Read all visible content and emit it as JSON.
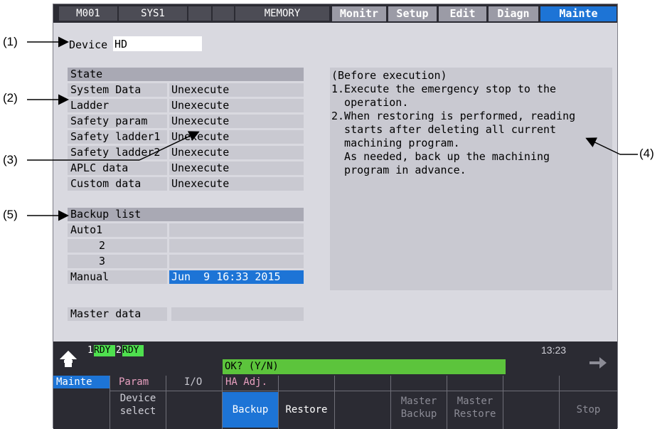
{
  "callouts": [
    "(1)",
    "(2)",
    "(3)",
    "(4)",
    "(5)"
  ],
  "topbar": {
    "cells": [
      "M001",
      "SYS1",
      "",
      "",
      "MEMORY"
    ],
    "tabs": [
      "Monitr",
      "Setup",
      "Edit",
      "Diagn",
      "Mainte"
    ],
    "active_tab": "Mainte"
  },
  "device": {
    "label": "Device",
    "value": "HD"
  },
  "state": {
    "header": "State",
    "rows": [
      {
        "label": "System Data",
        "value": "Unexecute"
      },
      {
        "label": "Ladder",
        "value": "Unexecute"
      },
      {
        "label": "Safety param",
        "value": "Unexecute"
      },
      {
        "label": "Safety ladder1",
        "value": "Unexecute"
      },
      {
        "label": "Safety ladder2",
        "value": "Unexecute"
      },
      {
        "label": "APLC data",
        "value": "Unexecute"
      },
      {
        "label": "Custom data",
        "value": "Unexecute"
      }
    ]
  },
  "backup_list": {
    "header": "Backup list",
    "rows": [
      {
        "label": "Auto1",
        "value": ""
      },
      {
        "label": "2",
        "value": ""
      },
      {
        "label": "3",
        "value": ""
      },
      {
        "label": "Manual",
        "value": "Jun  9 16:33 2015"
      }
    ]
  },
  "master_data": {
    "label": "Master data",
    "value": ""
  },
  "info_lines": [
    "(Before execution)",
    "1.Execute the emergency stop to the",
    "  operation.",
    "2.When restoring is performed, reading",
    "  starts after deleting all current",
    "  machining program.",
    "  As needed, back up the machining",
    "  program in advance."
  ],
  "status": {
    "ready1_num": "1",
    "ready1": "RDY",
    "ready2_num": "2",
    "ready2": "RDY",
    "time": "13:23",
    "prompt": "OK? (Y/N)"
  },
  "softkeys": [
    {
      "top": "Mainte",
      "bottom": ""
    },
    {
      "top": "Param",
      "bottom": "Device\nselect"
    },
    {
      "top": "I/O",
      "bottom": ""
    },
    {
      "top": "HA Adj.",
      "bottom": "Backup"
    },
    {
      "top": "",
      "bottom": "Restore"
    },
    {
      "top": "",
      "bottom": ""
    },
    {
      "top": "",
      "bottom": "Master\nBackup"
    },
    {
      "top": "",
      "bottom": "Master\nRestore"
    },
    {
      "top": "",
      "bottom": ""
    },
    {
      "top": "",
      "bottom": "Stop"
    }
  ],
  "colors": {
    "accent": "#1d74d6",
    "ready": "#4fe04f",
    "prompt_bar": "#5cc43c"
  }
}
